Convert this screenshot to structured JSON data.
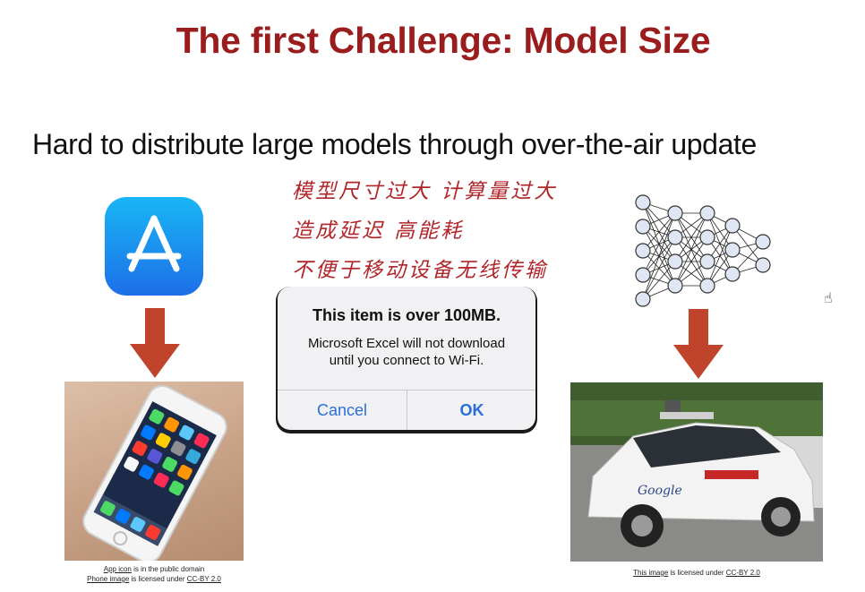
{
  "slide": {
    "title": "The first Challenge: Model Size",
    "subtitle": "Hard to distribute large models through over-the-air update",
    "handwritten_notes": [
      "模型尺寸过大  计算量过大",
      "造成延迟  高能耗",
      "不便于移动设备无线传输"
    ]
  },
  "dialog": {
    "title": "This item is over 100MB.",
    "message_line1": "Microsoft Excel will not download",
    "message_line2": "until you connect to Wi-Fi.",
    "cancel_label": "Cancel",
    "ok_label": "OK"
  },
  "credits": {
    "left_line1_link": "App icon",
    "left_line1_text": " is in the public domain",
    "left_line2_link": "Phone image",
    "left_line2_text": " is licensed under ",
    "left_line2_license": "CC-BY 2.0",
    "right_link": "This image",
    "right_text": " is licensed under ",
    "right_license": "CC-BY 2.0"
  },
  "images": {
    "car_logo": "Google"
  },
  "colors": {
    "title": "#9b1c1c",
    "arrow": "#c0442c",
    "appstore_blue": "#1f8ef0",
    "dialog_button": "#2a6fd8",
    "handwriting": "#b1262b"
  },
  "icons": {
    "app_store": "app-store-icon",
    "neural_network": "neural-network-icon",
    "cursor": "hand-cursor-icon"
  }
}
